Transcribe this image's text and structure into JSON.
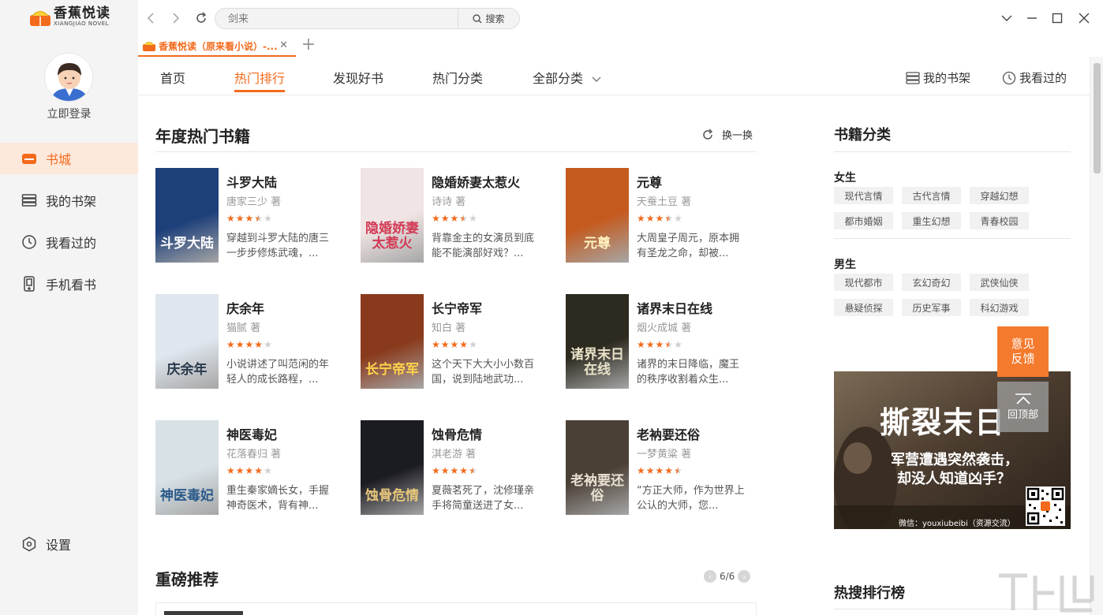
{
  "brand": {
    "name": "香蕉悦读",
    "sub": "XIANGJIAO NOVEL"
  },
  "sidebar": {
    "login": "立即登录",
    "items": [
      {
        "label": "书城",
        "icon": "store-icon"
      },
      {
        "label": "我的书架",
        "icon": "bookshelf-icon"
      },
      {
        "label": "我看过的",
        "icon": "clock-icon"
      },
      {
        "label": "手机看书",
        "icon": "phone-icon"
      }
    ],
    "settings": "设置"
  },
  "search": {
    "placeholder": "剑来",
    "button": "搜索"
  },
  "tabs": [
    {
      "label": "香蕉悦读（原来看小说）-..."
    }
  ],
  "nav": {
    "items": [
      "首页",
      "热门排行",
      "发现好书",
      "热门分类",
      "全部分类"
    ],
    "shelf": "我的书架",
    "history": "我看过的"
  },
  "hot": {
    "title": "年度热门书籍",
    "refresh": "换一换",
    "books": [
      {
        "title": "斗罗大陆",
        "author": "唐家三少 著",
        "rating": 3.5,
        "desc": "穿越到斗罗大陆的唐三一步步修炼武魂，...",
        "cover_text": "斗罗大陆",
        "cover_bg": "#1d3f7a",
        "cover_fg": "#ffffff"
      },
      {
        "title": "隐婚娇妻太惹火",
        "author": "诗诗 著",
        "rating": 3.5,
        "desc": "背靠金主的女演员到底能不能演部好戏？...",
        "cover_text": "隐婚娇妻太惹火",
        "cover_bg": "#f1e4e4",
        "cover_fg": "#d23a55"
      },
      {
        "title": "元尊",
        "author": "天蚕土豆 著",
        "rating": 3.5,
        "desc": "大周皇子周元，原本拥有圣龙之命，却被...",
        "cover_text": "元尊",
        "cover_bg": "#c45a1e",
        "cover_fg": "#fff3c0"
      },
      {
        "title": "庆余年",
        "author": "猫腻 著",
        "rating": 4,
        "desc": "小说讲述了叫范闲的年轻人的成长路程，...",
        "cover_text": "庆余年",
        "cover_bg": "#dfe6ee",
        "cover_fg": "#2b3a4d"
      },
      {
        "title": "长宁帝军",
        "author": "知白 著",
        "rating": 4,
        "desc": "这个天下大大小小数百国，说到陆地武功...",
        "cover_text": "长宁帝军",
        "cover_bg": "#8a3a1c",
        "cover_fg": "#ffd24a"
      },
      {
        "title": "诸界末日在线",
        "author": "烟火成城 著",
        "rating": 3.5,
        "desc": "诸界的末日降临，魔王的秩序收割着众生...",
        "cover_text": "诸界末日在线",
        "cover_bg": "#2d2a1f",
        "cover_fg": "#e9e2c8"
      },
      {
        "title": "神医毒妃",
        "author": "花落春归 著",
        "rating": 4,
        "desc": "重生秦家嫡长女，手握神奇医术，背有神...",
        "cover_text": "神医毒妃",
        "cover_bg": "#d7e1e6",
        "cover_fg": "#2b5a8a"
      },
      {
        "title": "蚀骨危情",
        "author": "淇老游 著",
        "rating": 4.5,
        "desc": "夏薇茗死了，沈修瑾亲手将简童送进了女...",
        "cover_text": "蚀骨危情",
        "cover_bg": "#1b1b22",
        "cover_fg": "#e8c77a"
      },
      {
        "title": "老衲要还俗",
        "author": "一梦黄粱 著",
        "rating": 4.5,
        "desc": "“方正大师，作为世界上公认的大师，您...",
        "cover_text": "老衲要还俗",
        "cover_bg": "#4b4036",
        "cover_fg": "#e8e0d0"
      }
    ]
  },
  "recommend": {
    "title": "重磅推荐",
    "page": "6/6"
  },
  "categories": {
    "title": "书籍分类",
    "groups": [
      {
        "name": "女生",
        "tags": [
          "现代言情",
          "古代言情",
          "穿越幻想",
          "都市婚姻",
          "重生幻想",
          "青春校园"
        ]
      },
      {
        "name": "男生",
        "tags": [
          "现代都市",
          "玄幻奇幻",
          "武侠仙侠",
          "悬疑侦探",
          "历史军事",
          "科幻游戏"
        ]
      }
    ]
  },
  "ad": {
    "title": "撕裂末日",
    "line1": "军营遭遇突然袭击，",
    "line2": "却没人知道凶手？",
    "wechat": "微信：youxiubeibi（资源交流）"
  },
  "float": {
    "feedback": "意见反馈",
    "top": "回顶部"
  },
  "hot_search": {
    "title": "热搜排行榜"
  },
  "colors": {
    "accent": "#f26a1b",
    "star": "#f26a1b",
    "star_off": "#d0d0d0"
  }
}
